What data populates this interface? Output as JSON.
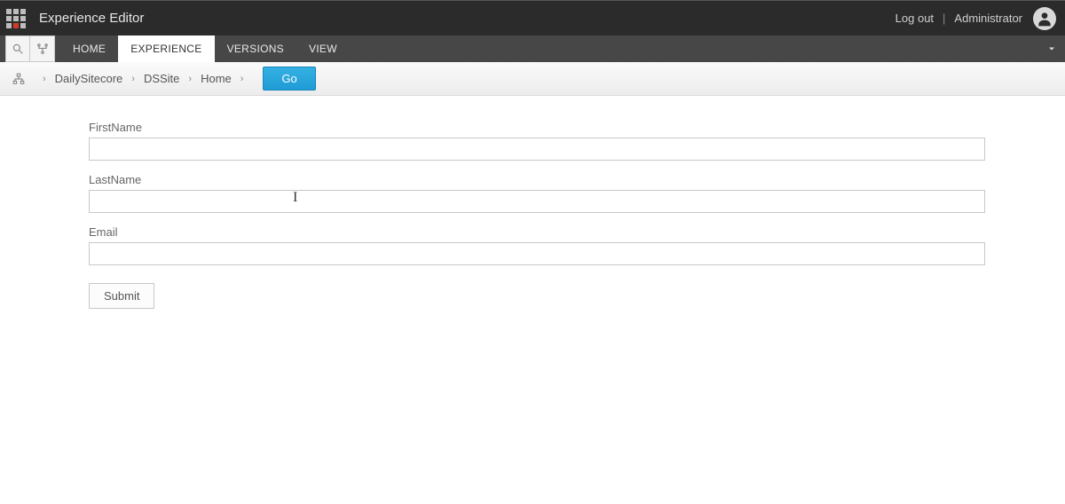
{
  "header": {
    "app_title": "Experience Editor",
    "logout": "Log out",
    "user": "Administrator"
  },
  "ribbon": {
    "tabs": [
      {
        "label": "HOME",
        "active": false
      },
      {
        "label": "EXPERIENCE",
        "active": true
      },
      {
        "label": "VERSIONS",
        "active": false
      },
      {
        "label": "VIEW",
        "active": false
      }
    ]
  },
  "breadcrumb": {
    "items": [
      "DailySitecore",
      "DSSite",
      "Home"
    ],
    "go": "Go"
  },
  "form": {
    "fields": [
      {
        "label": "FirstName",
        "value": ""
      },
      {
        "label": "LastName",
        "value": ""
      },
      {
        "label": "Email",
        "value": ""
      }
    ],
    "submit": "Submit"
  }
}
